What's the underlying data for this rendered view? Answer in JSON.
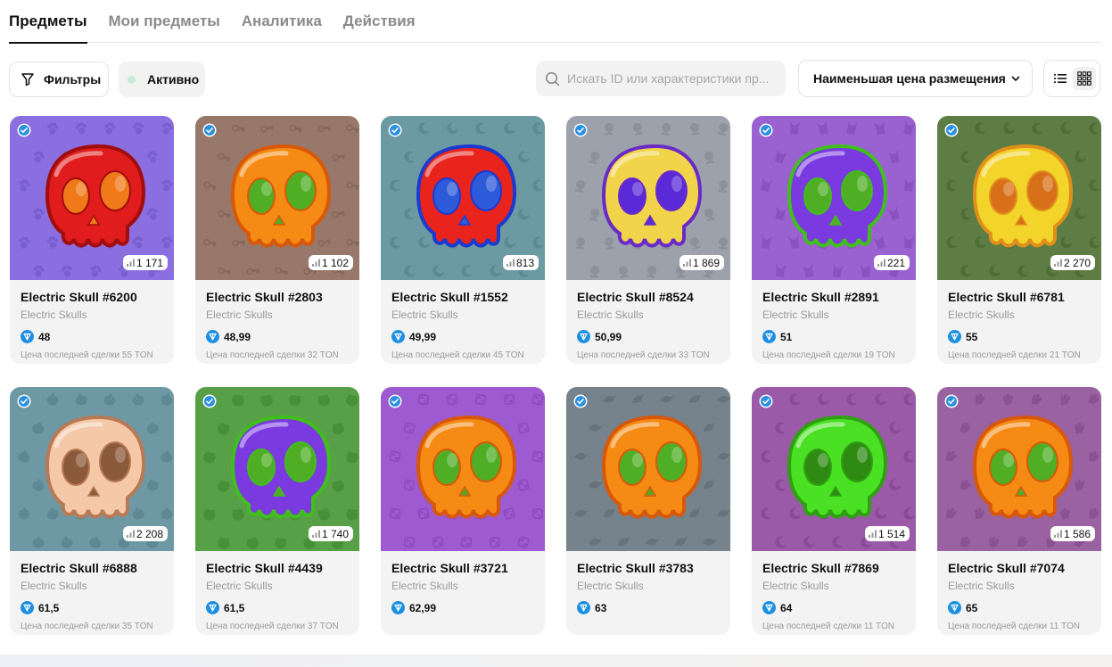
{
  "tabs": [
    {
      "label": "Предметы",
      "active": true
    },
    {
      "label": "Мои предметы",
      "active": false
    },
    {
      "label": "Аналитика",
      "active": false
    },
    {
      "label": "Действия",
      "active": false
    }
  ],
  "toolbar": {
    "filters_label": "Фильтры",
    "active_label": "Активно",
    "search_placeholder": "Искать ID или характеристики пр...",
    "sort_label": "Наименьшая цена размещения",
    "view_mode": "grid"
  },
  "accent": "#1d8fe0",
  "items": [
    {
      "name": "Electric Skull #6200",
      "collection": "Electric Skulls",
      "price": "48",
      "views": "1 171",
      "last_sale": "Цена последней сделки 55 TON",
      "bg": "#8b6fe0",
      "pattern": "#7a5fd0",
      "skull": "#e01c1c",
      "eyes": "#f07a1a",
      "outline": "#a00d0d",
      "pattern_icon": "paw"
    },
    {
      "name": "Electric Skull #2803",
      "collection": "Electric Skulls",
      "price": "48,99",
      "views": "1 102",
      "last_sale": "Цена последней сделки 32 TON",
      "bg": "#97786a",
      "pattern": "#86695c",
      "skull": "#f58a14",
      "eyes": "#4fae24",
      "outline": "#d8580a",
      "pattern_icon": "key"
    },
    {
      "name": "Electric Skull #1552",
      "collection": "Electric Skulls",
      "price": "49,99",
      "views": "813",
      "last_sale": "Цена последней сделки 45 TON",
      "bg": "#6b9aa3",
      "pattern": "#5c8a93",
      "skull": "#e8241c",
      "eyes": "#2d5ad8",
      "outline": "#1a3ad0",
      "pattern_icon": "moon"
    },
    {
      "name": "Electric Skull #8524",
      "collection": "Electric Skulls",
      "price": "50,99",
      "views": "1 869",
      "last_sale": "Цена последней сделки 33 TON",
      "bg": "#9da1ab",
      "pattern": "#8d919b",
      "skull": "#f2d44a",
      "eyes": "#5a2ad8",
      "outline": "#6a2ac8",
      "pattern_icon": "globe"
    },
    {
      "name": "Electric Skull #2891",
      "collection": "Electric Skulls",
      "price": "51",
      "views": "221",
      "last_sale": "Цена последней сделки 19 TON",
      "bg": "#9a62d0",
      "pattern": "#8a52c0",
      "skull": "#7a3ae0",
      "eyes": "#4fae24",
      "outline": "#3fc01a",
      "pattern_icon": "cat"
    },
    {
      "name": "Electric Skull #6781",
      "collection": "Electric Skulls",
      "price": "55",
      "views": "2 270",
      "last_sale": "Цена последней сделки 21 TON",
      "bg": "#5e7d44",
      "pattern": "#4f6d36",
      "skull": "#f2d42a",
      "eyes": "#d8701a",
      "outline": "#e0901a",
      "pattern_icon": "moon"
    },
    {
      "name": "Electric Skull #6888",
      "collection": "Electric Skulls",
      "price": "61,5",
      "views": "2 208",
      "last_sale": "Цена последней сделки 35 TON",
      "bg": "#6e98a3",
      "pattern": "#5e8893",
      "skull": "#f5c9a8",
      "eyes": "#8a5a3a",
      "outline": "#b87a54",
      "pattern_icon": "pumpkin"
    },
    {
      "name": "Electric Skull #4439",
      "collection": "Electric Skulls",
      "price": "61,5",
      "views": "1 740",
      "last_sale": "Цена последней сделки 37 TON",
      "bg": "#58a048",
      "pattern": "#489038",
      "skull": "#7a3ae0",
      "eyes": "#4fae24",
      "outline": "#3fc01a",
      "pattern_icon": "pot"
    },
    {
      "name": "Electric Skull #3721",
      "collection": "Electric Skulls",
      "price": "62,99",
      "views": "",
      "last_sale": "",
      "bg": "#9e5ad0",
      "pattern": "#8e4ac0",
      "skull": "#f58a14",
      "eyes": "#4fae24",
      "outline": "#d8580a",
      "pattern_icon": "dice"
    },
    {
      "name": "Electric Skull #3783",
      "collection": "Electric Skulls",
      "price": "63",
      "views": "",
      "last_sale": "",
      "bg": "#76828c",
      "pattern": "#66727c",
      "skull": "#f58a14",
      "eyes": "#4fae24",
      "outline": "#d8580a",
      "pattern_icon": "bird"
    },
    {
      "name": "Electric Skull #7869",
      "collection": "Electric Skulls",
      "price": "64",
      "views": "1 514",
      "last_sale": "Цена последней сделки 11 TON",
      "bg": "#9a5aa8",
      "pattern": "#8a4a98",
      "skull": "#4ae024",
      "eyes": "#2f8a14",
      "outline": "#2fa010",
      "pattern_icon": "moon"
    },
    {
      "name": "Electric Skull #7074",
      "collection": "Electric Skulls",
      "price": "65",
      "views": "1 586",
      "last_sale": "Цена последней сделки 11 TON",
      "bg": "#9a62a0",
      "pattern": "#8a5290",
      "skull": "#f58a14",
      "eyes": "#4fae24",
      "outline": "#d8580a",
      "pattern_icon": "hands"
    }
  ]
}
